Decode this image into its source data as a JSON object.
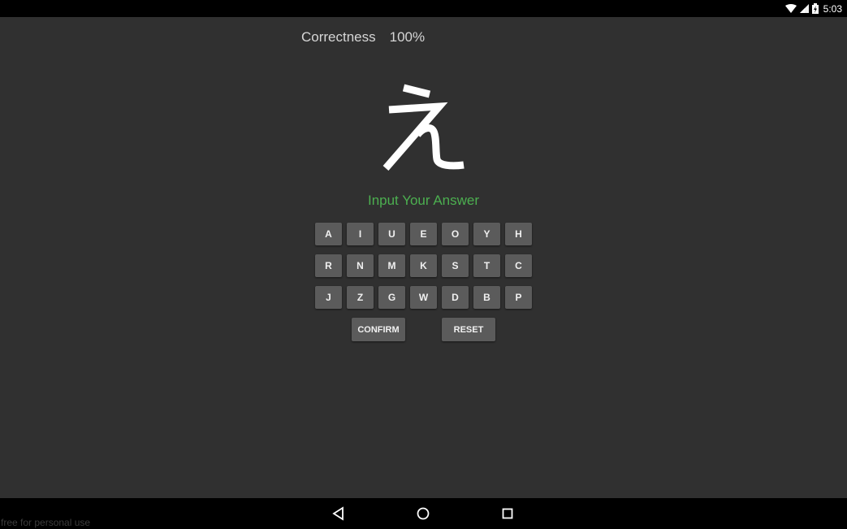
{
  "status_bar": {
    "time": "5:03",
    "icons": [
      "wifi-icon",
      "cell-signal-icon",
      "battery-charging-icon"
    ]
  },
  "quiz": {
    "correctness_label": "Correctness",
    "correctness_value": "100%",
    "character": "え",
    "prompt": "Input Your Answer",
    "prompt_color": "#4caf50"
  },
  "keypad": {
    "rows": [
      [
        "A",
        "I",
        "U",
        "E",
        "O",
        "Y",
        "H"
      ],
      [
        "R",
        "N",
        "M",
        "K",
        "S",
        "T",
        "C"
      ],
      [
        "J",
        "Z",
        "G",
        "W",
        "D",
        "B",
        "P"
      ]
    ],
    "confirm_label": "CONFIRM",
    "reset_label": "RESET"
  },
  "nav_bar": {
    "buttons": [
      "back-icon",
      "home-icon",
      "recents-icon"
    ]
  },
  "watermark": "free for personal use"
}
